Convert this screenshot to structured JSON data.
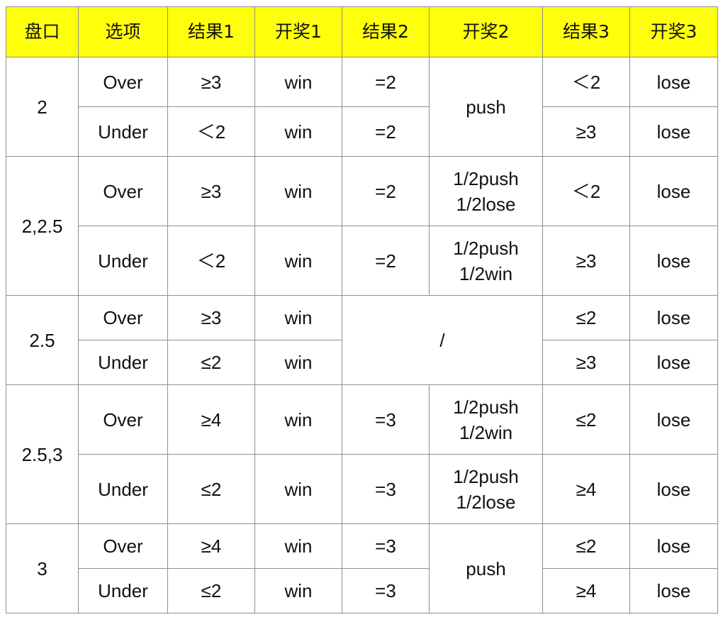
{
  "table": {
    "headers": [
      "盘口",
      "选项",
      "结果1",
      "开奖1",
      "结果2",
      "开奖2",
      "结果3",
      "开奖3"
    ],
    "groups": [
      {
        "line": "2",
        "rows": [
          {
            "option": "Over",
            "r1": "≥3",
            "p1": "win",
            "r2": "=2",
            "p2": "push",
            "r3": "＜2",
            "p3": "lose"
          },
          {
            "option": "Under",
            "r1": "＜2",
            "p1": "win",
            "r2": "=2",
            "r3": "≥3",
            "p3": "lose"
          }
        ]
      },
      {
        "line": "2,2.5",
        "rows": [
          {
            "option": "Over",
            "r1": "≥3",
            "p1": "win",
            "r2": "=2",
            "p2": "1/2push\n1/2lose",
            "r3": "＜2",
            "p3": "lose"
          },
          {
            "option": "Under",
            "r1": "＜2",
            "p1": "win",
            "r2": "=2",
            "p2": "1/2push\n1/2win",
            "r3": "≥3",
            "p3": "lose"
          }
        ]
      },
      {
        "line": "2.5",
        "rows": [
          {
            "option": "Over",
            "r1": "≥3",
            "p1": "win",
            "mid": "/",
            "r3": "≤2",
            "p3": "lose"
          },
          {
            "option": "Under",
            "r1": "≤2",
            "p1": "win",
            "r3": "≥3",
            "p3": "lose"
          }
        ]
      },
      {
        "line": "2.5,3",
        "rows": [
          {
            "option": "Over",
            "r1": "≥4",
            "p1": "win",
            "r2": "=3",
            "p2": "1/2push\n1/2win",
            "r3": "≤2",
            "p3": "lose"
          },
          {
            "option": "Under",
            "r1": "≤2",
            "p1": "win",
            "r2": "=3",
            "p2": "1/2push\n1/2lose",
            "r3": "≥4",
            "p3": "lose"
          }
        ]
      },
      {
        "line": "3",
        "rows": [
          {
            "option": "Over",
            "r1": "≥4",
            "p1": "win",
            "r2": "=3",
            "p2": "push",
            "r3": "≤2",
            "p3": "lose"
          },
          {
            "option": "Under",
            "r1": "≤2",
            "p1": "win",
            "r2": "=3",
            "r3": "≥4",
            "p3": "lose"
          }
        ]
      }
    ]
  }
}
